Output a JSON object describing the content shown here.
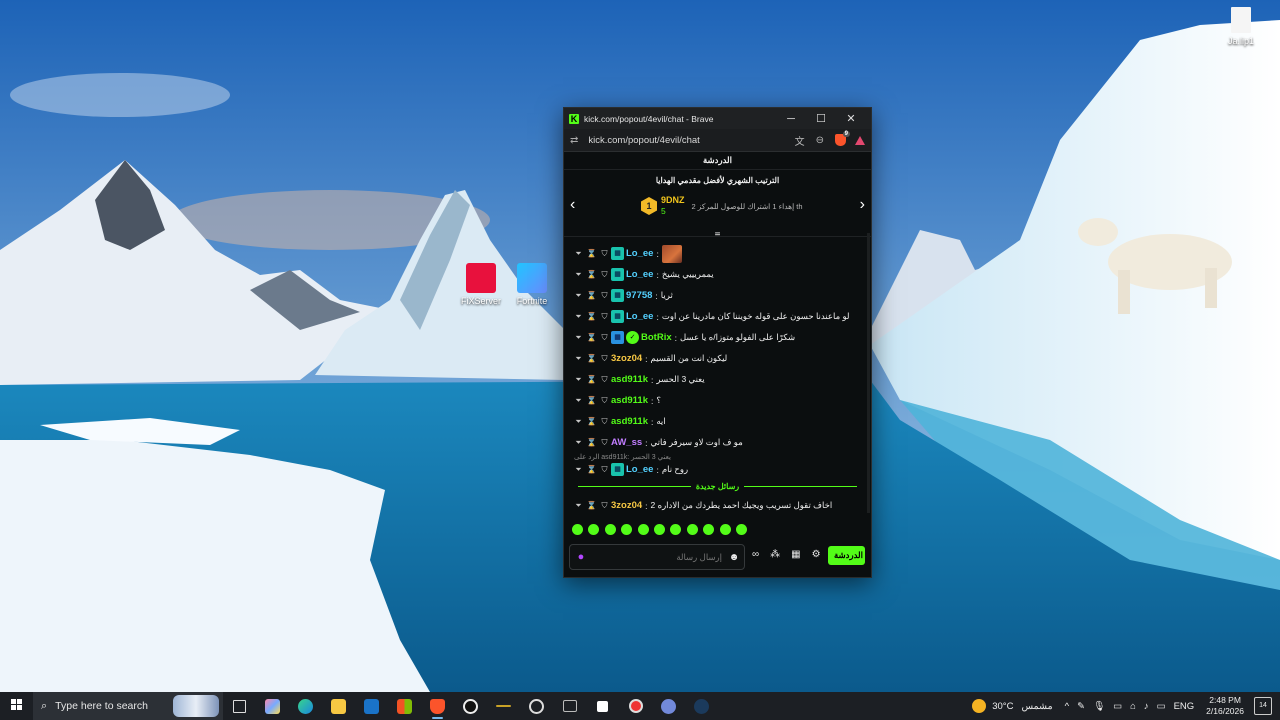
{
  "desktop": {
    "icons": [
      {
        "label": "FiXServer"
      },
      {
        "label": "Fortnite"
      },
      {
        "label": "Ja.lip1"
      }
    ]
  },
  "window": {
    "title": "kick.com/popout/4evil/chat - Brave",
    "url": "kick.com/popout/4evil/chat",
    "brave_badge": "9",
    "controls": {
      "minimize": "─",
      "maximize": "☐",
      "close": "✕"
    }
  },
  "chat": {
    "header": "الدردشة",
    "leaderboard": {
      "title": "الترتيب الشهري لأفضل مقدمي الهدايا",
      "rank": "1",
      "user": "9DNZ",
      "count": "5",
      "description": "إهداء 1 اشتراك للوصول للمركز 2 th"
    },
    "messages": [
      {
        "user": "Lo_ee",
        "user_color": "#53d1ff",
        "text": "",
        "has_emote": true,
        "badge": "sub"
      },
      {
        "user": "Lo_ee",
        "user_color": "#53d1ff",
        "text": "يممريييي يشيخ",
        "badge": "sub"
      },
      {
        "user": "97758",
        "user_color": "#53d1ff",
        "text": "ثريا",
        "badge": "sub"
      },
      {
        "user": "Lo_ee",
        "user_color": "#53d1ff",
        "text": "لو ماعندنا حسون على قوله خويننا كان مادرينا عن اوت",
        "badge": "sub"
      },
      {
        "user": "BotRix",
        "user_color": "#53fc18",
        "text": "شكرًا على الفولو متوزا/ه يا عسل",
        "badge": "bot"
      },
      {
        "user": "3zoz04",
        "user_color": "#f6c744",
        "text": "ليكون انت من القسيم",
        "badge": "none"
      },
      {
        "user": "asd911k",
        "user_color": "#53fc18",
        "text": "يعني 3 الحسر",
        "badge": "none"
      },
      {
        "user": "asd911k",
        "user_color": "#53fc18",
        "text": "؟",
        "badge": "none"
      },
      {
        "user": "asd911k",
        "user_color": "#53fc18",
        "text": "ايه",
        "badge": "none"
      },
      {
        "user": "AW_ss",
        "user_color": "#c17dff",
        "text": "مو ف اوت لاو سيرفر فاتي",
        "badge": "none"
      }
    ],
    "reply": {
      "context": "الرد على asd911k: يعني 3 الحسر",
      "user": "Lo_ee",
      "user_color": "#53d1ff",
      "text": "روح نام"
    },
    "new_messages_label": "رسائل جديدة",
    "latest": {
      "user": "3zoz04",
      "user_color": "#f6c744",
      "text": "اخاف تقول تسريب ويجيك احمد يطردك من الاداره 2"
    },
    "composer_placeholder": "إرسال رسالة",
    "chat_button": "الدردشة"
  },
  "taskbar": {
    "search_placeholder": "Type here to search",
    "weather_temp": "30°C",
    "weather_desc": "مشمس",
    "language": "ENG",
    "time": "2:48 PM",
    "date": "2/16/2026",
    "notifications": "14"
  }
}
